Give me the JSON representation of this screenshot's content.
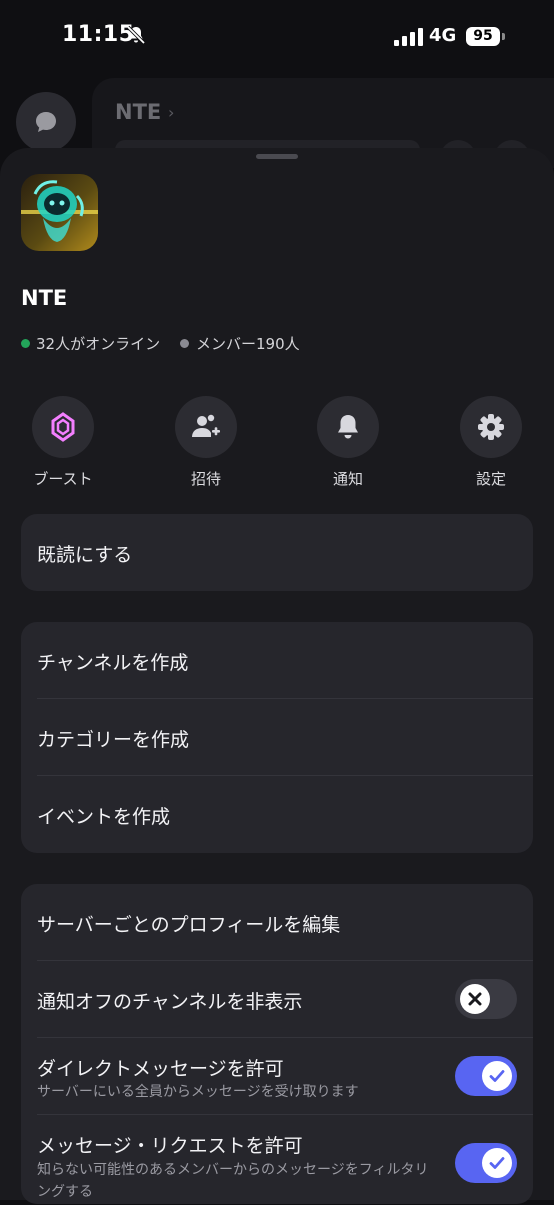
{
  "status_bar": {
    "time": "11:15",
    "network": "4G",
    "battery": "95"
  },
  "background": {
    "server_title": "NTE",
    "chevron": "›"
  },
  "server": {
    "name": "NTE",
    "online": "32人がオンライン",
    "members": "メンバー190人",
    "online_color": "#23a55a"
  },
  "actions": [
    {
      "label": "ブースト",
      "icon": "boost-icon"
    },
    {
      "label": "招待",
      "icon": "invite-user-icon"
    },
    {
      "label": "通知",
      "icon": "bell-icon"
    },
    {
      "label": "設定",
      "icon": "gear-icon"
    }
  ],
  "menu": {
    "mark_read": "既読にする",
    "create_channel": "チャンネルを作成",
    "create_category": "カテゴリーを作成",
    "create_event": "イベントを作成",
    "edit_profile": "サーバーごとのプロフィールを編集",
    "hide_muted": "通知オフのチャンネルを非表示",
    "allow_dm": "ダイレクトメッセージを許可",
    "allow_dm_sub": "サーバーにいる全員からメッセージを受け取ります",
    "allow_requests": "メッセージ・リクエストを許可",
    "allow_requests_sub": "知らない可能性のあるメンバーからのメッセージをフィルタリングする"
  },
  "toggles": {
    "hide_muted": false,
    "allow_dm": true,
    "allow_requests": true
  },
  "accent_color": "#5865f2"
}
